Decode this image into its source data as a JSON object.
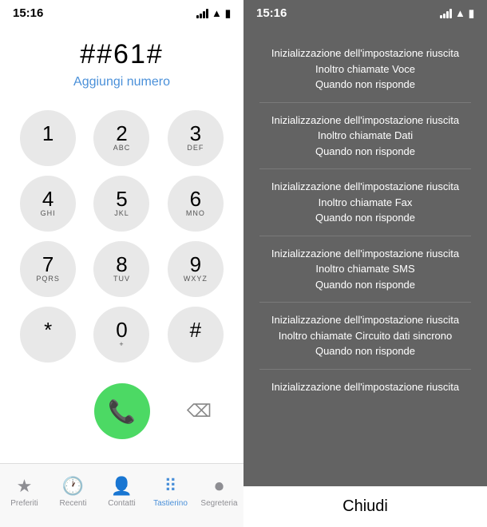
{
  "left": {
    "status": {
      "time": "15:16"
    },
    "dialer": {
      "number": "##61#",
      "add_label": "Aggiungi numero"
    },
    "keys": [
      {
        "number": "1",
        "letters": ""
      },
      {
        "number": "2",
        "letters": "ABC"
      },
      {
        "number": "3",
        "letters": "DEF"
      },
      {
        "number": "4",
        "letters": "GHI"
      },
      {
        "number": "5",
        "letters": "JKL"
      },
      {
        "number": "6",
        "letters": "MNO"
      },
      {
        "number": "7",
        "letters": "PQRS"
      },
      {
        "number": "8",
        "letters": "TUV"
      },
      {
        "number": "9",
        "letters": "WXYZ"
      },
      {
        "number": "*",
        "letters": ""
      },
      {
        "number": "0",
        "letters": "+"
      },
      {
        "number": "#",
        "letters": ""
      }
    ],
    "tabs": [
      {
        "label": "Preferiti",
        "icon": "★",
        "active": false
      },
      {
        "label": "Recenti",
        "icon": "🕐",
        "active": false
      },
      {
        "label": "Contatti",
        "icon": "👤",
        "active": false
      },
      {
        "label": "Tastierino",
        "icon": "⠿",
        "active": true
      },
      {
        "label": "Segreteria",
        "icon": "⏺",
        "active": false
      }
    ]
  },
  "right": {
    "status": {
      "time": "15:16"
    },
    "modal_items": [
      {
        "line1": "Inizializzazione dell'impostazione riuscita",
        "line2": "Inoltro chiamate Voce",
        "line3": "Quando non risponde"
      },
      {
        "line1": "Inizializzazione dell'impostazione riuscita",
        "line2": "Inoltro chiamate Dati",
        "line3": "Quando non risponde"
      },
      {
        "line1": "Inizializzazione dell'impostazione riuscita",
        "line2": "Inoltro chiamate Fax",
        "line3": "Quando non risponde"
      },
      {
        "line1": "Inizializzazione dell'impostazione riuscita",
        "line2": "Inoltro chiamate SMS",
        "line3": "Quando non risponde"
      },
      {
        "line1": "Inizializzazione dell'impostazione riuscita",
        "line2": "Inoltro chiamate Circuito dati sincrono",
        "line3": "Quando non risponde"
      },
      {
        "line1": "Inizializzazione dell'impostazione riuscita",
        "line2": "",
        "line3": ""
      }
    ],
    "close_label": "Chiudi"
  }
}
